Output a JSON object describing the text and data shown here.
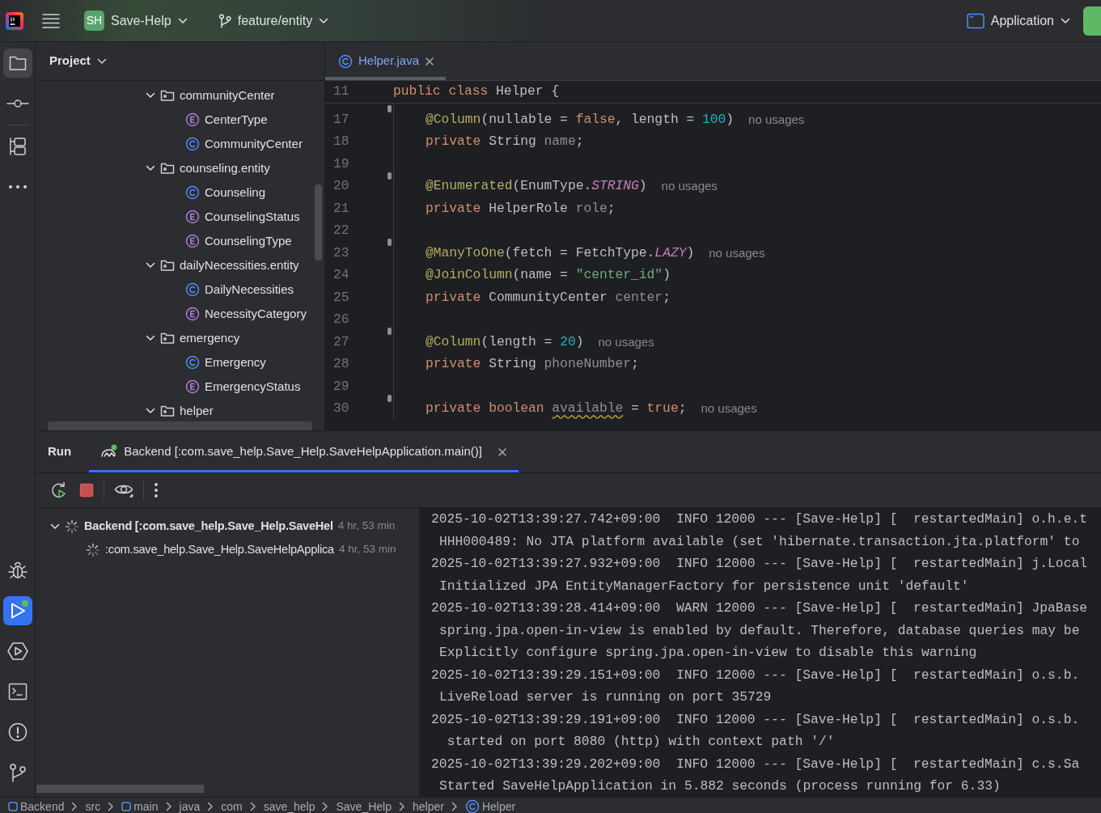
{
  "title_bar": {
    "project_badge": "SH",
    "project": "Save-Help",
    "branch": "feature/entity",
    "run_config": "Application"
  },
  "tool_strip": {
    "top": [
      {
        "kind": "folder",
        "selected": true
      },
      {
        "kind": "commit",
        "selected": false
      },
      {
        "kind": "structure",
        "selected": false
      },
      {
        "kind": "more",
        "selected": false
      }
    ],
    "bottom": [
      {
        "kind": "debug",
        "selected": false,
        "running": false
      },
      {
        "kind": "run",
        "selected": true,
        "running": true
      },
      {
        "kind": "services",
        "selected": false,
        "running": false
      },
      {
        "kind": "terminal",
        "selected": false,
        "running": false
      },
      {
        "kind": "problems",
        "selected": false,
        "running": false
      },
      {
        "kind": "git",
        "selected": false,
        "running": false
      }
    ]
  },
  "project_panel": {
    "title": "Project",
    "tree": [
      {
        "kind": "folder",
        "label": "communityCenter",
        "expanded": true,
        "children": [
          {
            "kind": "enum",
            "label": "CenterType"
          },
          {
            "kind": "class",
            "label": "CommunityCenter"
          }
        ]
      },
      {
        "kind": "folder",
        "label": "counseling.entity",
        "expanded": true,
        "children": [
          {
            "kind": "class",
            "label": "Counseling"
          },
          {
            "kind": "enum",
            "label": "CounselingStatus"
          },
          {
            "kind": "enum",
            "label": "CounselingType"
          }
        ]
      },
      {
        "kind": "folder",
        "label": "dailyNecessities.entity",
        "expanded": true,
        "children": [
          {
            "kind": "class",
            "label": "DailyNecessities"
          },
          {
            "kind": "enum",
            "label": "NecessityCategory"
          }
        ]
      },
      {
        "kind": "folder",
        "label": "emergency",
        "expanded": true,
        "children": [
          {
            "kind": "class",
            "label": "Emergency"
          },
          {
            "kind": "enum",
            "label": "EmergencyStatus"
          }
        ]
      },
      {
        "kind": "folder",
        "label": "helper",
        "expanded": true
      }
    ]
  },
  "editor": {
    "tabs": [
      {
        "kind": "class",
        "label": "Helper.java",
        "selected": true
      }
    ],
    "sticky_line": {
      "number": "11",
      "tokens": [
        {
          "kind": "keyword",
          "text": "public class "
        },
        {
          "kind": "plain",
          "text": "Helper {"
        }
      ]
    },
    "lines": [
      {
        "number": "17",
        "marker": true,
        "tokens": [
          {
            "kind": "annotation",
            "text": "@Column"
          },
          {
            "kind": "plain",
            "text": "(nullable = "
          },
          {
            "kind": "keyword",
            "text": "false"
          },
          {
            "kind": "plain",
            "text": ", length = "
          },
          {
            "kind": "number",
            "text": "100"
          },
          {
            "kind": "plain",
            "text": ")"
          },
          {
            "kind": "hint",
            "text": "no usages"
          }
        ]
      },
      {
        "number": "18",
        "marker": false,
        "tokens": [
          {
            "kind": "keyword",
            "text": "private "
          },
          {
            "kind": "plain",
            "text": "String "
          },
          {
            "kind": "field",
            "text": "name"
          },
          {
            "kind": "plain",
            "text": ";"
          }
        ]
      },
      {
        "number": "19",
        "marker": false
      },
      {
        "number": "20",
        "marker": true,
        "tokens": [
          {
            "kind": "annotation",
            "text": "@Enumerated"
          },
          {
            "kind": "plain",
            "text": "(EnumType."
          },
          {
            "kind": "constant",
            "text": "STRING"
          },
          {
            "kind": "plain",
            "text": ")"
          },
          {
            "kind": "hint",
            "text": "no usages"
          }
        ]
      },
      {
        "number": "21",
        "marker": false,
        "tokens": [
          {
            "kind": "keyword",
            "text": "private "
          },
          {
            "kind": "plain",
            "text": "HelperRole "
          },
          {
            "kind": "field",
            "text": "role"
          },
          {
            "kind": "plain",
            "text": ";"
          }
        ]
      },
      {
        "number": "22",
        "marker": false
      },
      {
        "number": "23",
        "marker": true,
        "tokens": [
          {
            "kind": "annotation",
            "text": "@ManyToOne"
          },
          {
            "kind": "plain",
            "text": "(fetch = FetchType."
          },
          {
            "kind": "constant",
            "text": "LAZY"
          },
          {
            "kind": "plain",
            "text": ")"
          },
          {
            "kind": "hint",
            "text": "no usages"
          }
        ]
      },
      {
        "number": "24",
        "marker": false,
        "tokens": [
          {
            "kind": "annotation",
            "text": "@JoinColumn"
          },
          {
            "kind": "plain",
            "text": "(name = "
          },
          {
            "kind": "string",
            "text": "\"center_id\""
          },
          {
            "kind": "plain",
            "text": ")"
          }
        ]
      },
      {
        "number": "25",
        "marker": false,
        "tokens": [
          {
            "kind": "keyword",
            "text": "private "
          },
          {
            "kind": "plain",
            "text": "CommunityCenter "
          },
          {
            "kind": "field",
            "text": "center"
          },
          {
            "kind": "plain",
            "text": ";"
          }
        ]
      },
      {
        "number": "26",
        "marker": false
      },
      {
        "number": "27",
        "marker": true,
        "tokens": [
          {
            "kind": "annotation",
            "text": "@Column"
          },
          {
            "kind": "plain",
            "text": "(length = "
          },
          {
            "kind": "number",
            "text": "20"
          },
          {
            "kind": "plain",
            "text": ")"
          },
          {
            "kind": "hint",
            "text": "no usages"
          }
        ]
      },
      {
        "number": "28",
        "marker": false,
        "tokens": [
          {
            "kind": "keyword",
            "text": "private "
          },
          {
            "kind": "plain",
            "text": "String "
          },
          {
            "kind": "field",
            "text": "phoneNumber"
          },
          {
            "kind": "plain",
            "text": ";"
          }
        ]
      },
      {
        "number": "29",
        "marker": false
      },
      {
        "number": "30",
        "marker": true,
        "tokens": [
          {
            "kind": "keyword",
            "text": "private boolean "
          },
          {
            "kind": "warning",
            "text": "available"
          },
          {
            "kind": "plain",
            "text": " = "
          },
          {
            "kind": "keyword",
            "text": "true"
          },
          {
            "kind": "plain",
            "text": ";"
          },
          {
            "kind": "hint",
            "text": "no usages"
          }
        ]
      }
    ]
  },
  "run_panel": {
    "title": "Run",
    "tabs": [
      {
        "label": "Backend [:com.save_help.Save_Help.SaveHelpApplication.main()]",
        "selected": true,
        "running": true
      }
    ],
    "tree": [
      {
        "label": "Backend [:com.save_help.Save_Help.SaveHel",
        "time": "4 hr, 53 min",
        "expanded": true,
        "children": [
          {
            "label": ":com.save_help.Save_Help.SaveHelpApplica",
            "time": "4 hr, 53 min"
          }
        ]
      }
    ],
    "console": [
      {
        "kind": "entry",
        "text": "2025-10-02T13:39:27.742+09:00  INFO 12000 --- [Save-Help] [  restartedMain] o.h.e.t"
      },
      {
        "kind": "message",
        "text": "HHH000489: No JTA platform available (set 'hibernate.transaction.jta.platform' to"
      },
      {
        "kind": "entry",
        "text": "2025-10-02T13:39:27.932+09:00  INFO 12000 --- [Save-Help] [  restartedMain] j.Local"
      },
      {
        "kind": "message",
        "text": "Initialized JPA EntityManagerFactory for persistence unit 'default'"
      },
      {
        "kind": "entry",
        "text": "2025-10-02T13:39:28.414+09:00  WARN 12000 --- [Save-Help] [  restartedMain] JpaBase"
      },
      {
        "kind": "message",
        "text": "spring.jpa.open-in-view is enabled by default. Therefore, database queries may be"
      },
      {
        "kind": "message",
        "text": "Explicitly configure spring.jpa.open-in-view to disable this warning"
      },
      {
        "kind": "entry",
        "text": "2025-10-02T13:39:29.151+09:00  INFO 12000 --- [Save-Help] [  restartedMain] o.s.b."
      },
      {
        "kind": "message",
        "text": "LiveReload server is running on port 35729"
      },
      {
        "kind": "entry",
        "text": "2025-10-02T13:39:29.191+09:00  INFO 12000 --- [Save-Help] [  restartedMain] o.s.b."
      },
      {
        "kind": "message",
        "text": " started on port 8080 (http) with context path '/'"
      },
      {
        "kind": "entry",
        "text": "2025-10-02T13:39:29.202+09:00  INFO 12000 --- [Save-Help] [  restartedMain] c.s.Sa"
      },
      {
        "kind": "message",
        "text": "Started SaveHelpApplication in 5.882 seconds (process running for 6.33)"
      }
    ]
  },
  "breadcrumbs": [
    {
      "kind": "module",
      "label": "Backend"
    },
    {
      "kind": "folder",
      "label": "src"
    },
    {
      "kind": "module",
      "label": "main"
    },
    {
      "kind": "folder",
      "label": "java"
    },
    {
      "kind": "folder",
      "label": "com"
    },
    {
      "kind": "folder",
      "label": "save_help"
    },
    {
      "kind": "folder",
      "label": "Save_Help"
    },
    {
      "kind": "folder",
      "label": "helper"
    },
    {
      "kind": "class",
      "label": "Helper"
    }
  ]
}
